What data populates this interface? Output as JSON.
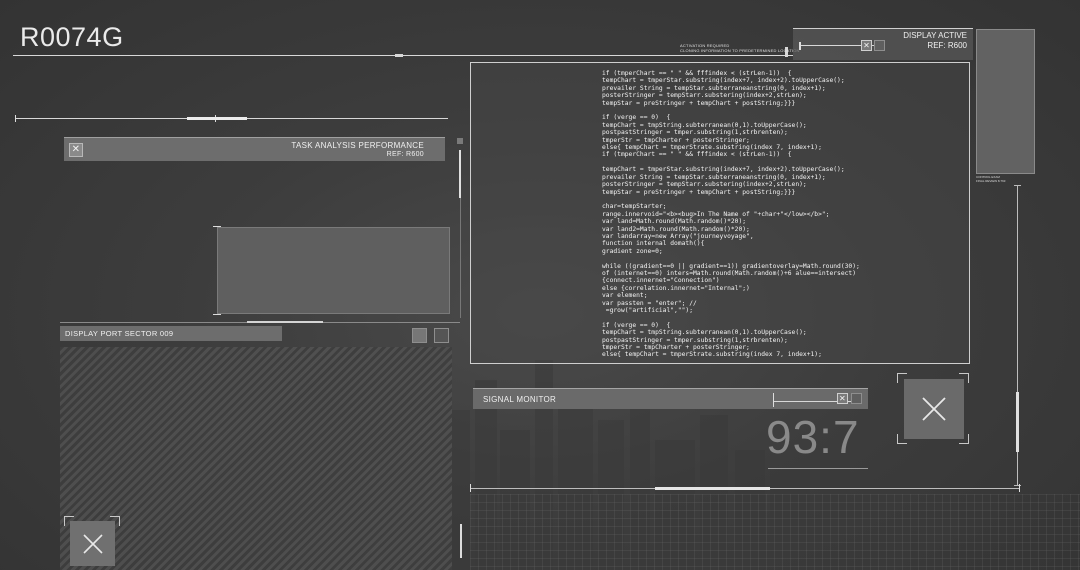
{
  "header": {
    "code": "R0074G",
    "activation_line1": "ACTIVATION REQUIRED",
    "activation_line2": "CLONING INFORMATION TO PREDETERMINED LOCATION"
  },
  "display_active": {
    "title": "DISPLAY ACTIVE",
    "ref": "REF: R600",
    "close_icon": "close-icon"
  },
  "side_caption": {
    "line1": "CONTROL EXAM",
    "line2": "FINAL REVIEW 8.763"
  },
  "task_panel": {
    "title": "TASK ANALYSIS PERFORMANCE",
    "ref": "REF: R600",
    "close_icon": "close-icon"
  },
  "display_port": {
    "title": "DISPLAY PORT SECTOR 009"
  },
  "signal_monitor": {
    "title": "SIGNAL MONITOR",
    "readout": "93:7",
    "close_icon": "close-icon"
  },
  "code_lines": [
    "if (tmperChart == \" \" && fffindex < (strLen-1))  {",
    "tempChart = tmperStar.substring(index+7, index+2).toUpperCase();",
    "prevailer String = tempStar.subterraneanstring(0, index+1);",
    "posterStringer = tempStarr.substering(index+2,strLen);",
    "tempStar = preStringer + tempChart + postString;}}}",
    "",
    "if (verge == 0)  {",
    "tempChart = tmpString.subterranean(0,1).toUpperCase();",
    "postpastStringer = tmper.substring(1,strbrenten);",
    "tmperStr = tmpCharter + posterStringer;",
    "else{ tempChart = tmperStrate.substring(index 7, index+1);",
    "if (tmperChart == \" \" && fffindex < (strLen-1))  {",
    "",
    "tempChart = tmperStar.substring(index+7, index+2).toUpperCase();",
    "prevailer String = tempStar.subterraneanstring(0, index+1);",
    "posterStringer = tempStarr.substering(index+2,strLen);",
    "tempStar = preStringer + tempChart + postString;}}}",
    "",
    "char=tempStarter;",
    "range.innervoid=\"<b><bug>In The Name of \"+char+\"</low></b>\";",
    "var land=Math.round(Math.random()*20);",
    "var land2=Math.round(Math.random()*20);",
    "var landarray=new Array(\"journeyvoyage\",",
    "function internal domath(){",
    "gradient zone=0;",
    "",
    "while ((gradient==0 || gradient==1)) gradientoverlay=Math.round(30);",
    "of (internet==0) inters=Math.round(Math.random()+6 alue==intersect)",
    "{connect.innernet=\"Connection\")",
    "else {correlation.innernet=\"Internal\";)",
    "var element;",
    "var passten = \"enter\"; //",
    " =grow(\"artificial\",\"\");",
    "",
    "if (verge == 0)  {",
    "tempChart = tmpString.subterranean(0,1).toUpperCase();",
    "postpastStringer = tmper.substring(1,strbrenten);",
    "tmperStr = tmpCharter + posterStringer;",
    "else{ tempChart = tmperStrate.substring(index 7, index+1);"
  ]
}
